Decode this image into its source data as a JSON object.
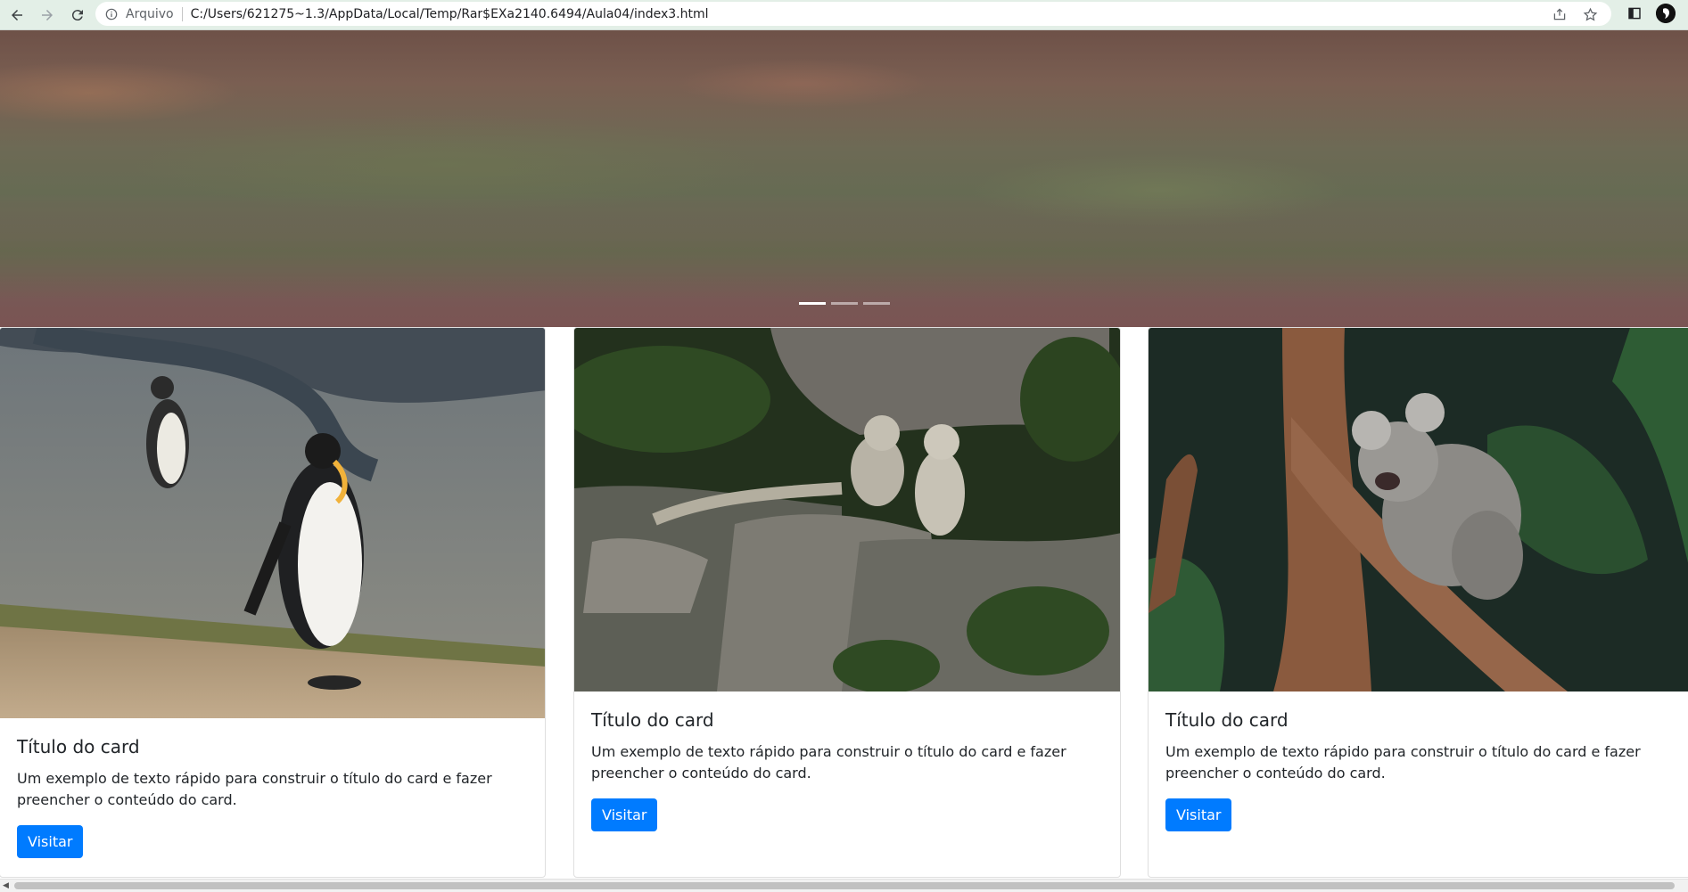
{
  "browser": {
    "scheme_label": "Arquivo",
    "url": "C:/Users/621275~1.3/AppData/Local/Temp/Rar$EXa2140.6494/Aula04/index3.html",
    "icons": [
      "back-arrow-icon",
      "forward-arrow-icon",
      "reload-icon",
      "info-icon",
      "share-icon",
      "star-icon",
      "side-panel-icon",
      "profile-avatar"
    ]
  },
  "carousel": {
    "slide_count": 3,
    "active_index": 0
  },
  "cards": [
    {
      "image": "penguins",
      "title": "Título do card",
      "text": "Um exemplo de texto rápido para construir o título do card e fazer preencher o conteúdo do card.",
      "button": "Visitar"
    },
    {
      "image": "snow-leopards",
      "title": "Título do card",
      "text": "Um exemplo de texto rápido para construir o título do card e fazer preencher o conteúdo do card.",
      "button": "Visitar"
    },
    {
      "image": "koala",
      "title": "Título do card",
      "text": "Um exemplo de texto rápido para construir o título do card e fazer preencher o conteúdo do card.",
      "button": "Visitar"
    }
  ],
  "colors": {
    "primary_button": "#007bff",
    "toolbar": "#e3efe7"
  }
}
